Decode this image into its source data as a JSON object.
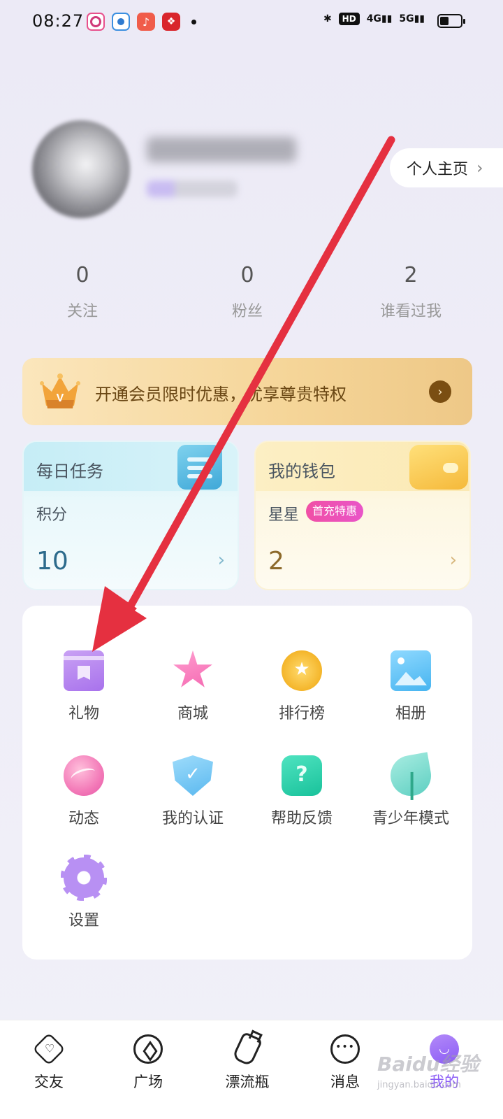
{
  "status_bar": {
    "time": "08:27",
    "network_a": "4G",
    "network_b": "5G",
    "hd": "HD"
  },
  "profile": {
    "name": "",
    "homepage_label": "个人主页"
  },
  "stats": [
    {
      "value": "0",
      "label": "关注"
    },
    {
      "value": "0",
      "label": "粉丝"
    },
    {
      "value": "2",
      "label": "谁看过我"
    }
  ],
  "vip": {
    "text": "开通会员限时优惠，优享尊贵特权",
    "crown_letter": "V"
  },
  "tasks_card": {
    "title": "每日任务",
    "sub_label": "积分",
    "value": "10"
  },
  "wallet_card": {
    "title": "我的钱包",
    "sub_label": "星星",
    "badge": "首充特惠",
    "value": "2"
  },
  "menu": [
    {
      "label": "礼物",
      "icon": "gift-icon"
    },
    {
      "label": "商城",
      "icon": "star-wand-icon"
    },
    {
      "label": "排行榜",
      "icon": "medal-icon"
    },
    {
      "label": "相册",
      "icon": "photo-icon"
    },
    {
      "label": "动态",
      "icon": "globe-icon"
    },
    {
      "label": "我的认证",
      "icon": "shield-check-icon"
    },
    {
      "label": "帮助反馈",
      "icon": "help-icon"
    },
    {
      "label": "青少年模式",
      "icon": "leaf-icon"
    },
    {
      "label": "设置",
      "icon": "gear-icon"
    }
  ],
  "bottom_nav": [
    {
      "label": "交友",
      "icon": "heart-tab-icon"
    },
    {
      "label": "广场",
      "icon": "compass-icon"
    },
    {
      "label": "漂流瓶",
      "icon": "bottle-icon"
    },
    {
      "label": "消息",
      "icon": "chat-icon"
    },
    {
      "label": "我的",
      "icon": "me-icon",
      "active": true
    }
  ],
  "watermark": {
    "text": "Baidu经验",
    "sub": "jingyan.baidu.com"
  },
  "colors": {
    "accent_purple": "#8b5cf6",
    "annotation_red": "#e53040",
    "badge_pink": "#f04fa5"
  }
}
